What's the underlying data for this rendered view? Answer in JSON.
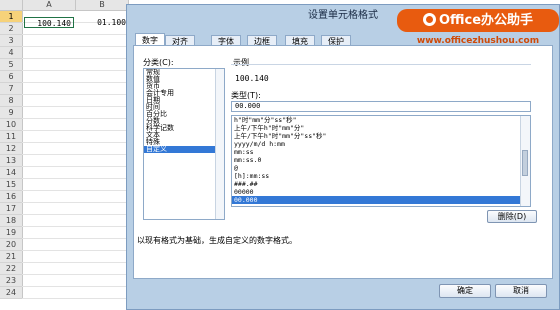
{
  "sheet": {
    "columns": [
      "A",
      "B"
    ],
    "rows": [
      "1",
      "2",
      "3",
      "4",
      "5",
      "6",
      "7",
      "8",
      "9",
      "10",
      "11",
      "12",
      "13",
      "14",
      "15",
      "16",
      "17",
      "18",
      "19",
      "20",
      "21",
      "22",
      "23",
      "24"
    ],
    "cells": {
      "A1": "100.140",
      "B1": "01.100"
    }
  },
  "dialog": {
    "title": "设置单元格格式",
    "tabs": [
      "数字",
      "对齐",
      "字体",
      "边框",
      "填充",
      "保护"
    ],
    "category_label": "分类(C):",
    "categories": [
      "常规",
      "数值",
      "货币",
      "会计专用",
      "日期",
      "时间",
      "百分比",
      "分数",
      "科学记数",
      "文本",
      "特殊",
      "自定义"
    ],
    "selected_category": "自定义",
    "sample_label": "示例",
    "sample_value": "100.140",
    "type_label": "类型(T):",
    "type_value": "00.000",
    "formats": [
      "h\"时\"mm\"分\"ss\"秒\"",
      "上午/下午h\"时\"mm\"分\"",
      "上午/下午h\"时\"mm\"分\"ss\"秒\"",
      "yyyy/m/d h:mm",
      "mm:ss",
      "mm:ss.0",
      "@",
      "[h]:mm:ss",
      "###.##",
      "00000",
      "00.000"
    ],
    "selected_format": "00.000",
    "delete_label": "删除(D)",
    "description": "以现有格式为基础，生成自定义的数字格式。",
    "ok_label": "确定",
    "cancel_label": "取消"
  },
  "watermark": {
    "brand": "Office办公助手",
    "url": "www.officezhushou.com"
  },
  "colors": {
    "selection": "#3378d6",
    "brand": "#e85b0f",
    "dialog_bg": "#b8cfe5"
  }
}
